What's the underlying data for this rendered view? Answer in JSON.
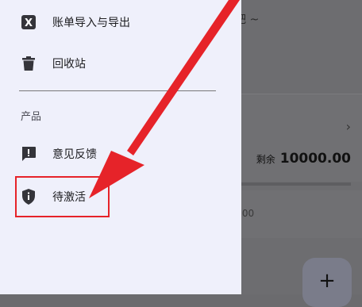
{
  "background": {
    "top_text": "吧 ~",
    "balance_label": "剩余",
    "balance_value": "10000.00",
    "partial_value": ".00",
    "fab_label": "+"
  },
  "drawer": {
    "items": [
      {
        "label": "账单导入与导出",
        "icon": "excel-x-icon"
      },
      {
        "label": "回收站",
        "icon": "trash-icon"
      }
    ],
    "section_label": "产品",
    "product_items": [
      {
        "label": "意见反馈",
        "icon": "feedback-icon"
      },
      {
        "label": "待激活",
        "icon": "shield-info-icon"
      }
    ]
  },
  "annotation": {
    "color": "#e62329"
  }
}
